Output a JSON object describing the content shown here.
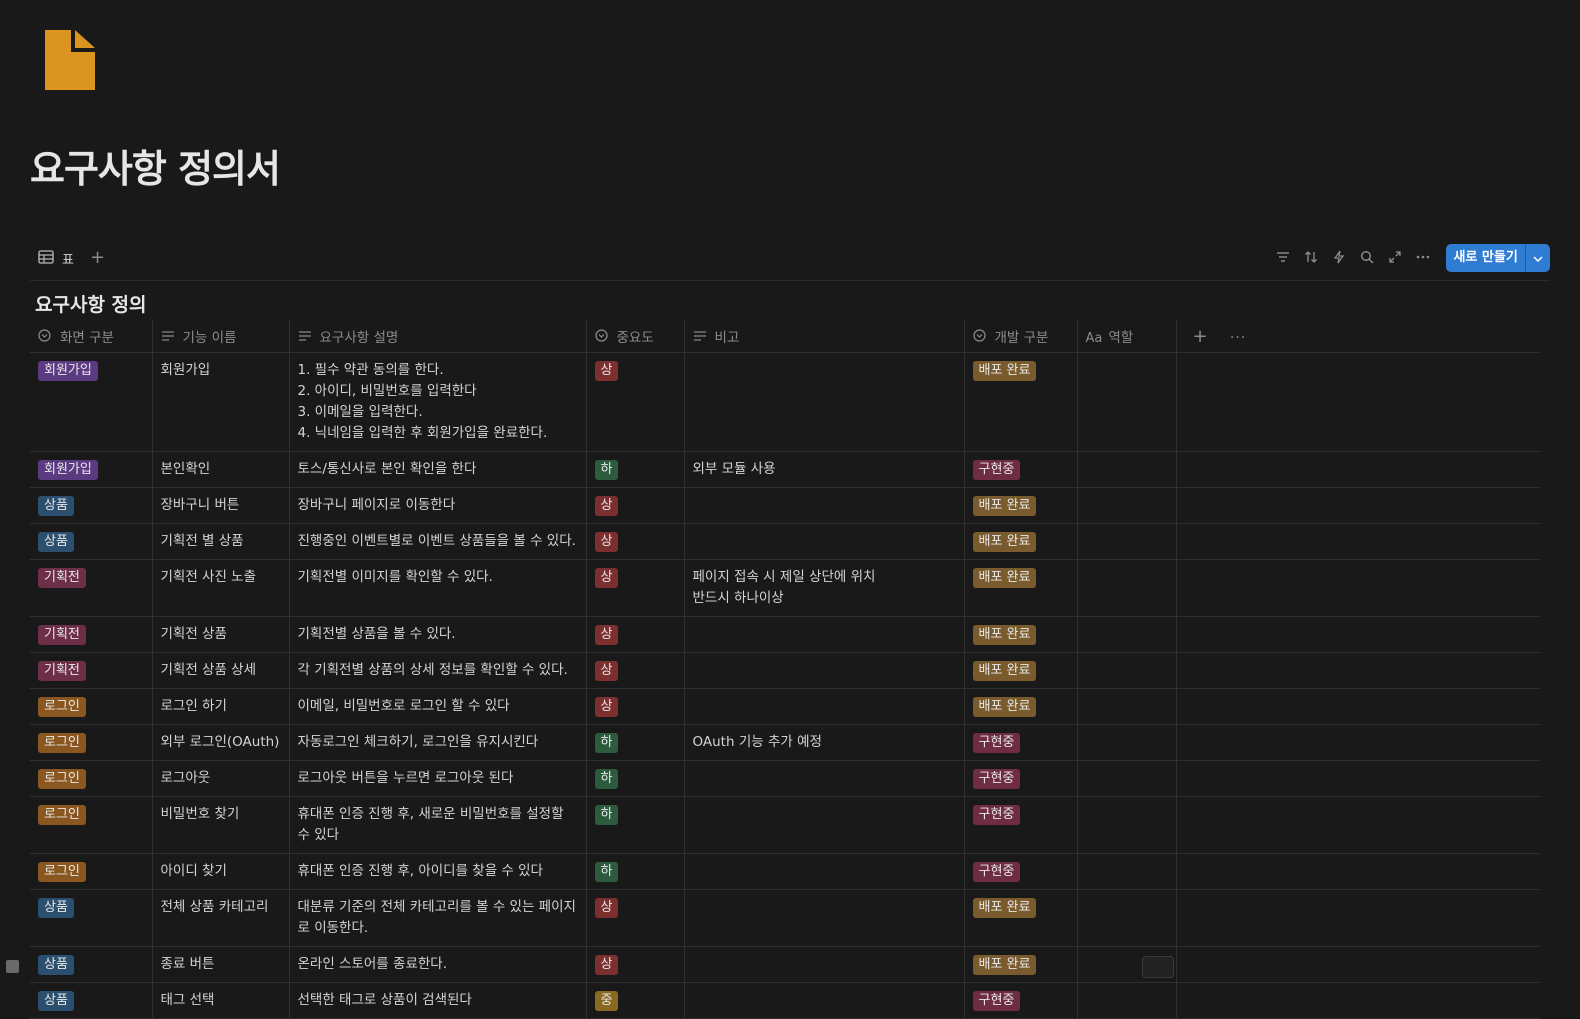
{
  "page": {
    "title": "요구사항 정의서",
    "icon": "document-icon",
    "icon_color": "#d9951f"
  },
  "toolbar": {
    "view_label": "표",
    "new_button": "새로 만들기",
    "icons": [
      "filter-icon",
      "sort-icon",
      "lightning-icon",
      "search-icon",
      "expand-icon",
      "more-icon"
    ]
  },
  "database": {
    "title": "요구사항 정의",
    "columns": [
      "화면 구분",
      "기능 이름",
      "요구사항 설명",
      "중요도",
      "비고",
      "개발 구분",
      "역할"
    ]
  },
  "rows": [
    {
      "screen": "회원가입",
      "screen_color": "purple",
      "feature": "회원가입",
      "desc": "1. 필수 약관 동의를 한다.\n2. 아이디, 비밀번호를 입력한다\n3. 이메일을 입력한다.\n4. 닉네임을 입력한 후 회원가입을 완료한다.",
      "priority": "상",
      "note": "",
      "status": "배포 완료"
    },
    {
      "screen": "회원가입",
      "screen_color": "purple",
      "feature": "본인확인",
      "desc": "토스/통신사로 본인 확인을 한다",
      "priority": "하",
      "note": "외부 모듈 사용",
      "status": "구현중"
    },
    {
      "screen": "상품",
      "screen_color": "blue",
      "feature": "장바구니 버튼",
      "desc": "장바구니 페이지로 이동한다",
      "priority": "상",
      "note": "",
      "status": "배포 완료"
    },
    {
      "screen": "상품",
      "screen_color": "blue",
      "feature": "기획전 별 상품",
      "desc": "진행중인 이벤트별로 이벤트 상품들을 볼 수 있다.",
      "priority": "상",
      "note": "",
      "status": "배포 완료"
    },
    {
      "screen": "기획전",
      "screen_color": "pink",
      "feature": "기획전 사진 노출",
      "desc": "기획전별 이미지를 확인할 수 있다.",
      "priority": "상",
      "note": "페이지 접속 시 제일 상단에 위치\n반드시 하나이상",
      "status": "배포 완료"
    },
    {
      "screen": "기획전",
      "screen_color": "pink",
      "feature": "기획전 상품",
      "desc": "기획전별 상품을 볼 수 있다.",
      "priority": "상",
      "note": "",
      "status": "배포 완료"
    },
    {
      "screen": "기획전",
      "screen_color": "pink",
      "feature": "기획전 상품 상세",
      "desc": "각 기획전별 상품의 상세 정보를 확인할 수 있다.",
      "priority": "상",
      "note": "",
      "status": "배포 완료"
    },
    {
      "screen": "로그인",
      "screen_color": "orange",
      "feature": "로그인 하기",
      "desc": "이메일, 비밀번호로 로그인 할 수 있다",
      "priority": "상",
      "note": "",
      "status": "배포 완료"
    },
    {
      "screen": "로그인",
      "screen_color": "orange",
      "feature": "외부 로그인(OAuth)",
      "desc": "자동로그인 체크하기, 로그인을 유지시킨다",
      "priority": "하",
      "note": "OAuth 기능 추가 예정",
      "status": "구현중"
    },
    {
      "screen": "로그인",
      "screen_color": "orange",
      "feature": "로그아웃",
      "desc": "로그아웃 버튼을 누르면 로그아웃 된다",
      "priority": "하",
      "note": "",
      "status": "구현중"
    },
    {
      "screen": "로그인",
      "screen_color": "orange",
      "feature": "비밀번호 찾기",
      "desc": "휴대폰 인증 진행 후, 새로운 비밀번호를 설정할 수 있다",
      "priority": "하",
      "note": "",
      "status": "구현중"
    },
    {
      "screen": "로그인",
      "screen_color": "orange",
      "feature": "아이디 찾기",
      "desc": "휴대폰 인증 진행 후, 아이디를 찾을 수 있다",
      "priority": "하",
      "note": "",
      "status": "구현중"
    },
    {
      "screen": "상품",
      "screen_color": "blue",
      "feature": "전체 상품 카테고리",
      "desc": "대분류 기준의 전체 카테고리를 볼 수 있는 페이지로 이동한다.",
      "priority": "상",
      "note": "",
      "status": "배포 완료"
    },
    {
      "screen": "상품",
      "screen_color": "blue",
      "feature": "종료 버튼",
      "desc": "온라인 스토어를 종료한다.",
      "priority": "상",
      "note": "",
      "status": "배포 완료"
    },
    {
      "screen": "상품",
      "screen_color": "blue",
      "feature": "태그 선택",
      "desc": "선택한 태그로 상품이 검색된다",
      "priority": "중",
      "note": "",
      "status": "구현중"
    }
  ],
  "priority_colors": {
    "상": "#7b2f2f",
    "하": "#2c5b3d",
    "중": "#8a6a20"
  },
  "status_colors": {
    "배포 완료": "#7a5b2d",
    "구현중": "#6e2d43"
  }
}
